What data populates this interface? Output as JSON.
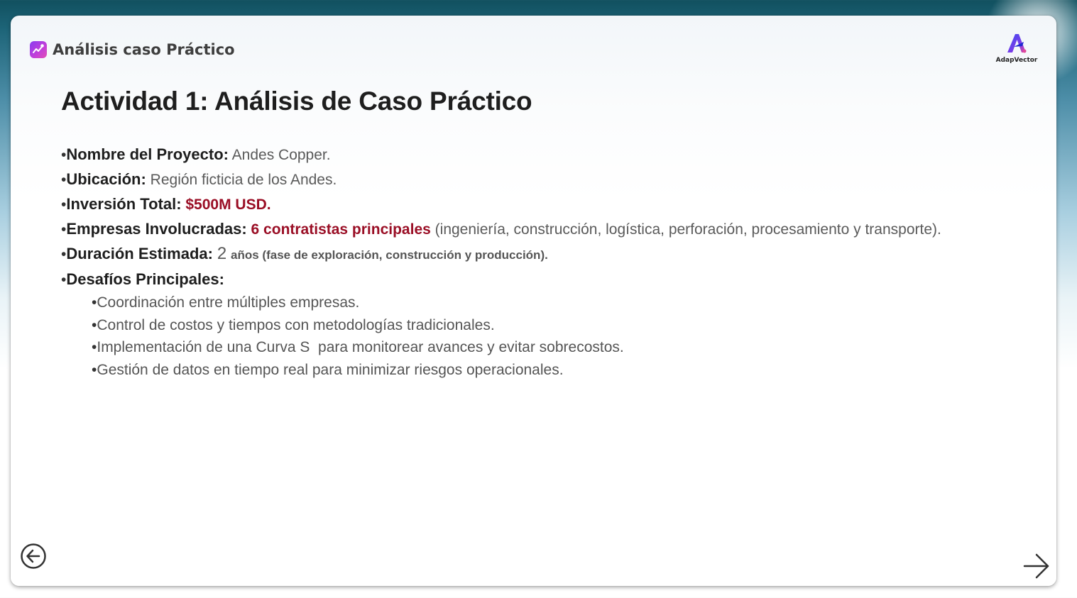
{
  "app": {
    "title": "Análisis caso Práctico"
  },
  "brand": {
    "name": "AdapVector"
  },
  "slide": {
    "title": "Actividad 1: Análisis de Caso Práctico",
    "bullet_char": "•",
    "items": [
      {
        "label": "Nombre del Proyecto:",
        "value": "Andes Copper."
      },
      {
        "label": "Ubicación:",
        "value": "Región ficticia de los Andes."
      },
      {
        "label": "Inversión Total:",
        "highlight": "$500M USD."
      },
      {
        "label": "Empresas Involucradas:",
        "highlight": "6 contratistas principales",
        "value": "(ingeniería, construcción, logística, perforación, procesamiento y transporte)."
      },
      {
        "label": "Duración Estimada:",
        "value_large": "2",
        "value_small": "años (fase de exploración, construcción y producción)."
      },
      {
        "label": "Desafíos Principales:"
      }
    ],
    "sub_items": [
      "Coordinación entre múltiples empresas.",
      "Control de costos y tiempos con metodologías tradicionales.",
      "Implementación de una Curva S  para monitorear avances y evitar sobrecostos.",
      "Gestión de datos en tiempo real para minimizar riesgos operacionales."
    ]
  },
  "colors": {
    "highlight": "#9a0e25",
    "app_icon": "#b23fe0",
    "header_bg": "#11505f"
  },
  "icons": {
    "app": "trending-chart-icon",
    "prev": "arrow-left-circle-icon",
    "next": "arrow-right-icon"
  }
}
